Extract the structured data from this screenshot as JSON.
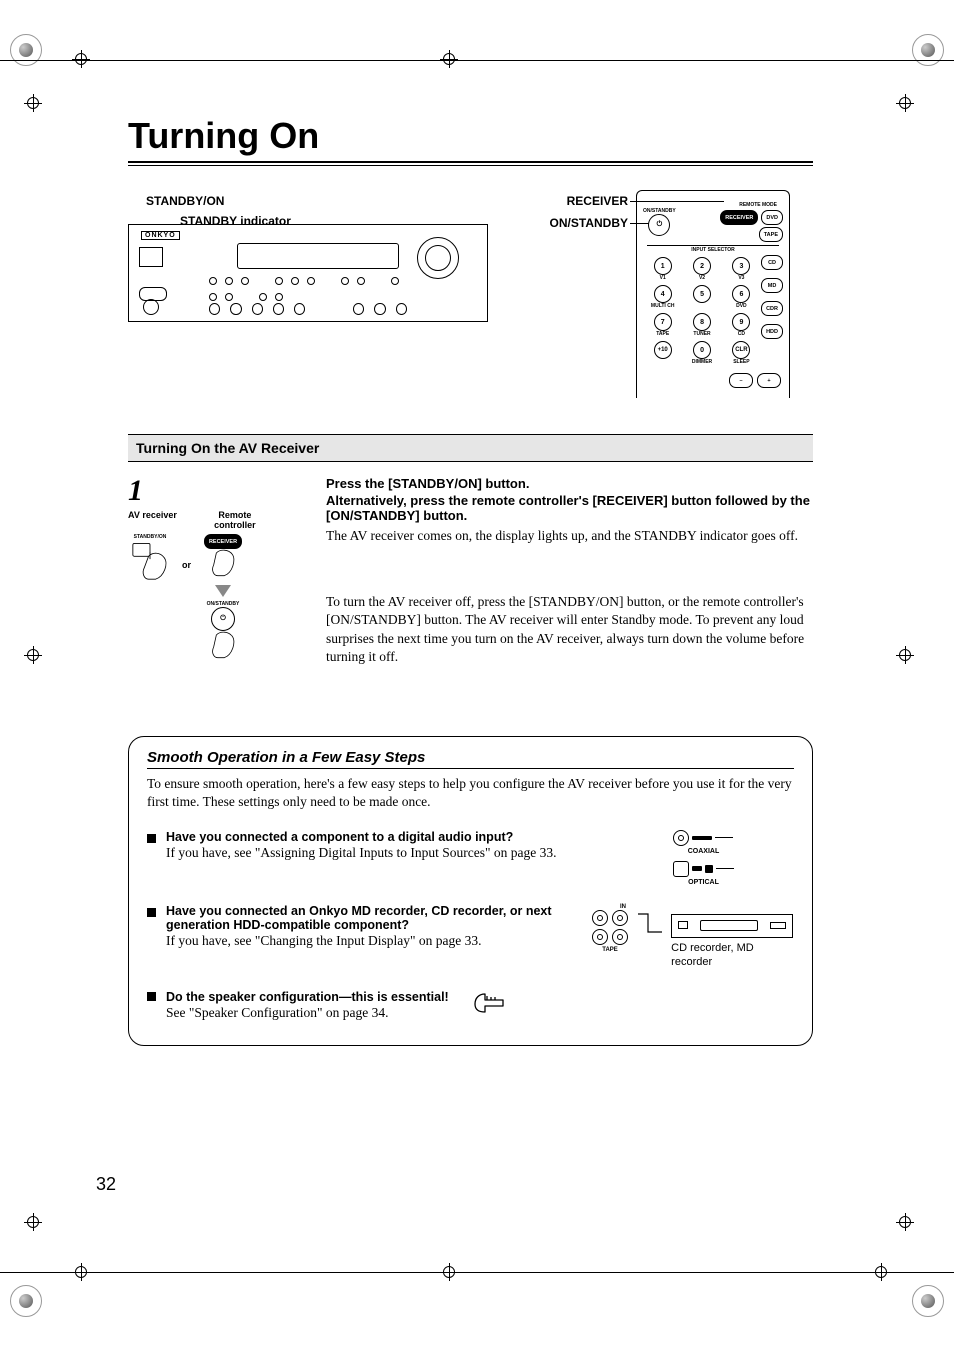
{
  "page": {
    "title": "Turning On",
    "number": "32"
  },
  "diagrams": {
    "receiver": {
      "standby_on": "STANDBY/ON",
      "standby_indicator": "STANDBY indicator",
      "brand": "ONKYO"
    },
    "remote": {
      "receiver_label": "RECEIVER",
      "on_standby_label": "ON/STANDBY",
      "top_on_standby": "ON/STANDBY",
      "remote_mode": "REMOTE MODE",
      "receiver_btn": "RECEIVER",
      "dvd_btn": "DVD",
      "tape_btn": "TAPE",
      "input_selector": "INPUT SELECTOR",
      "side_cd": "CD",
      "side_md": "MD",
      "side_cdr": "CDR",
      "side_hdd": "HDD",
      "grid": {
        "r1": [
          "1",
          "2",
          "3"
        ],
        "r1_sub": [
          "V1",
          "V2",
          "V3"
        ],
        "r2": [
          "4",
          "5",
          "6"
        ],
        "r2_sub": [
          "MULTI CH",
          "",
          "DVD"
        ],
        "r3": [
          "7",
          "8",
          "9"
        ],
        "r3_sub": [
          "TAPE",
          "TUNER",
          "CD"
        ],
        "r4": [
          "+10",
          "0",
          "CLR"
        ],
        "r4_sub": [
          "",
          "DIMMER",
          "SLEEP"
        ]
      },
      "vol_plus": "+",
      "vol_minus": "–"
    }
  },
  "section1": {
    "heading": "Turning On the AV Receiver",
    "step_number": "1",
    "av_receiver_label": "AV receiver",
    "remote_controller_label": "Remote controller",
    "standby_on_btn": "STANDBY/ON",
    "or": "or",
    "receiver_pill": "RECEIVER",
    "on_standby_btn": "ON/STANDBY",
    "line1": "Press the [STANDBY/ON] button.",
    "line2": "Alternatively, press the remote controller's [RECEIVER] button followed by the [ON/STANDBY] button.",
    "line3": "The AV receiver comes on, the display lights up, and the STANDBY indicator goes off.",
    "line4": "To turn the AV receiver off, press the [STANDBY/ON] button, or the remote controller's [ON/STANDBY] button. The AV receiver will enter Standby mode. To prevent any loud surprises the next time you turn on the AV receiver, always turn down the volume before turning it off."
  },
  "smooth": {
    "title": "Smooth Operation in a Few Easy Steps",
    "intro": "To ensure smooth operation, here's a few easy steps to help you configure the AV receiver before you use it for the very first time. These settings only need to be made once.",
    "items": [
      {
        "q": "Have you connected a component to a digital audio input?",
        "a": "If you have, see \"Assigning Digital Inputs to Input Sources\" on page 33.",
        "labels": {
          "coaxial": "COAXIAL",
          "optical": "OPTICAL"
        }
      },
      {
        "q": "Have you connected an Onkyo MD recorder, CD recorder, or next generation HDD-compatible component?",
        "a": "If you have, see \"Changing the Input Display\" on page 33.",
        "labels": {
          "in": "IN",
          "tape": "TAPE",
          "caption": "CD recorder, MD recorder"
        }
      },
      {
        "q": "Do the speaker configuration—this is essential!",
        "a": "See \"Speaker Configuration\" on page 34."
      }
    ]
  }
}
